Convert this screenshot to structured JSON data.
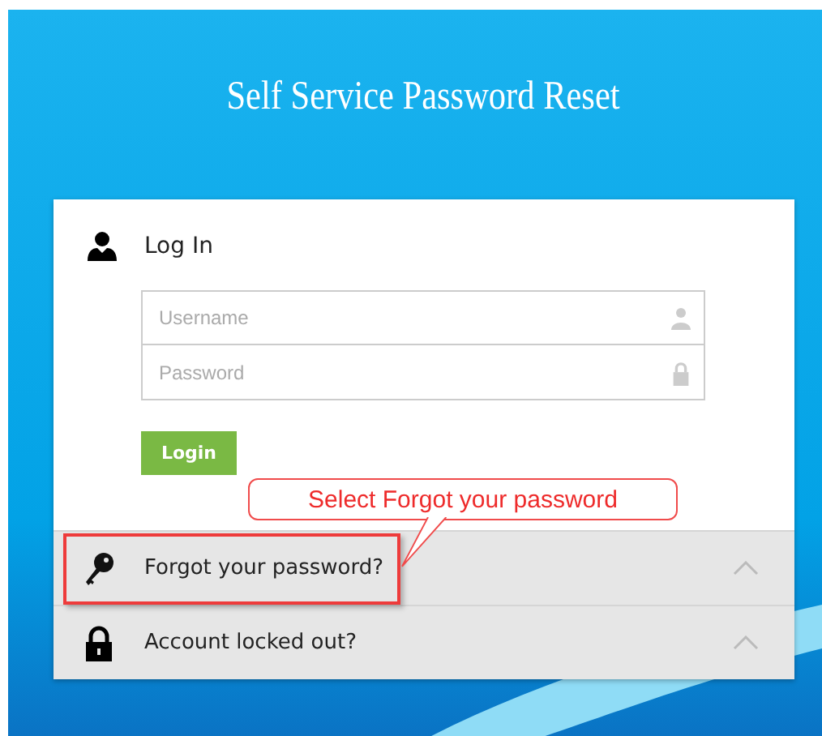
{
  "header": {
    "title": "Self Service Password Reset"
  },
  "login": {
    "heading": "Log In",
    "username": {
      "placeholder": "Username"
    },
    "password": {
      "placeholder": "Password"
    },
    "button": "Login"
  },
  "callout": {
    "text": "Select Forgot your password"
  },
  "sections": [
    {
      "kind": "key",
      "label": "Forgot your password?",
      "highlighted": true
    },
    {
      "kind": "lock",
      "label": "Account locked out?",
      "highlighted": false
    }
  ]
}
